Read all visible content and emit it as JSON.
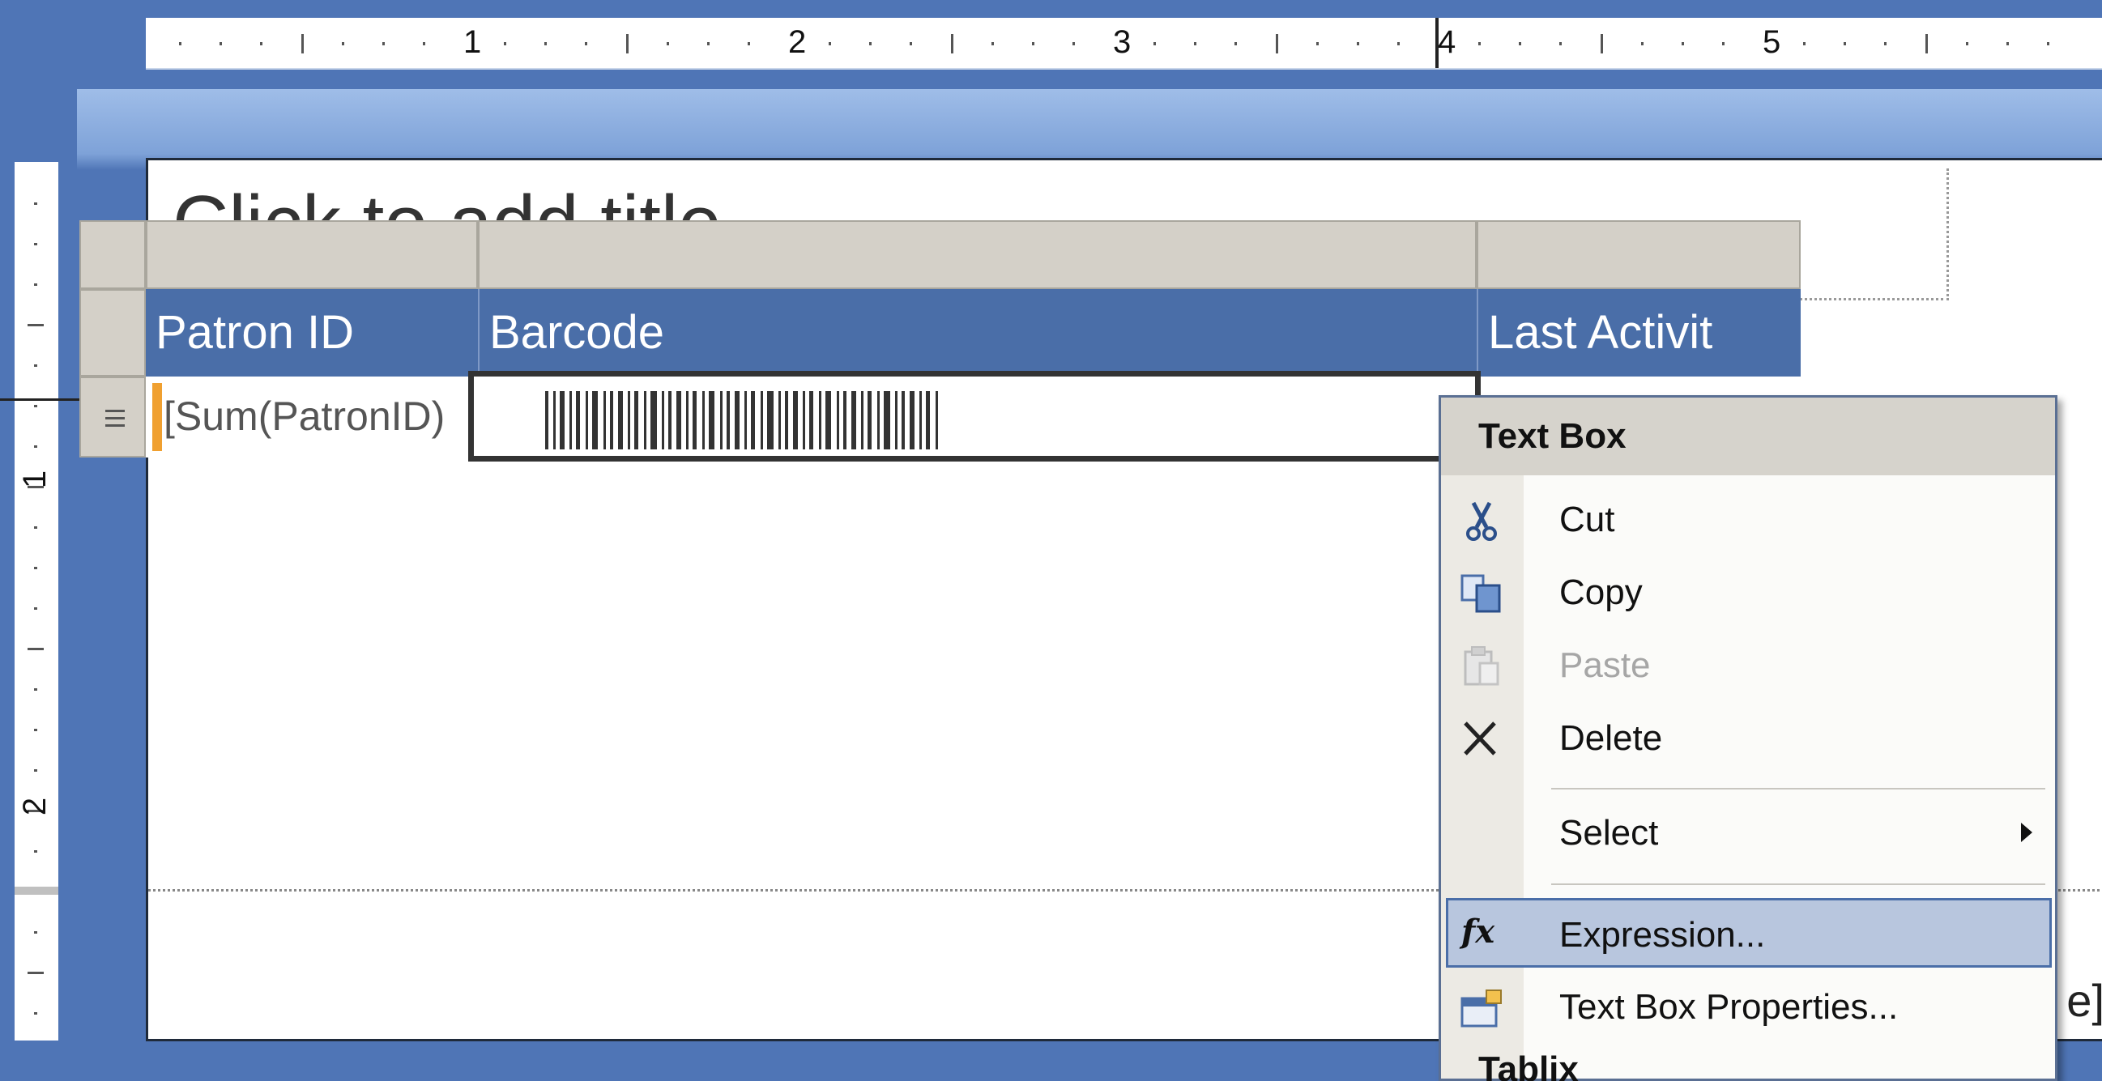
{
  "ruler": {
    "labels": [
      "1",
      "2",
      "3",
      "4",
      "5"
    ],
    "vertical_labels": [
      "1",
      "2"
    ]
  },
  "page": {
    "title_placeholder": "Click to add title",
    "footer_fragment": "e]"
  },
  "table": {
    "headers": [
      "Patron ID",
      "Barcode",
      "Last Activit"
    ],
    "row_handle_icon": "list-icon",
    "row": {
      "patron_expr": "[Sum(PatronID)",
      "barcode_icon": "barcode-icon"
    }
  },
  "context_menu": {
    "title": "Text Box",
    "items": [
      {
        "label": "Cut",
        "icon": "scissors-icon",
        "enabled": true
      },
      {
        "label": "Copy",
        "icon": "copy-icon",
        "enabled": true
      },
      {
        "label": "Paste",
        "icon": "paste-icon",
        "enabled": false
      },
      {
        "label": "Delete",
        "icon": "delete-x-icon",
        "enabled": true
      },
      {
        "label": "Select",
        "icon": "",
        "enabled": true,
        "submenu": true
      },
      {
        "label": "Expression...",
        "icon": "fx-icon",
        "enabled": true,
        "highlighted": true
      },
      {
        "label": "Text Box Properties...",
        "icon": "properties-icon",
        "enabled": true
      }
    ],
    "next_section": "Tablix"
  },
  "colors": {
    "header_blue": "#4a6ea8",
    "highlight": "#b8c6de",
    "workspace": "#4f75b6"
  }
}
